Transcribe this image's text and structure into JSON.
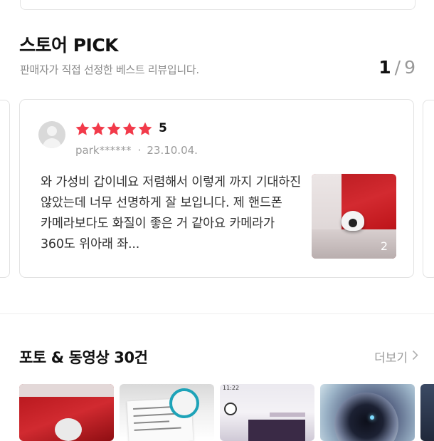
{
  "store_pick": {
    "title": "스토어 PICK",
    "subtitle": "판매자가 직접 선정한 베스트 리뷰입니다.",
    "pager": {
      "current": "1",
      "separator": "/",
      "total": "9"
    }
  },
  "review": {
    "rating": "5",
    "stars_filled": 5,
    "star_color": "#f23a4a",
    "author": "park******",
    "date": "23.10.04.",
    "text": "와 가성비 갑이네요 저렴해서 이렇게 까지 기대하진 않았는데 너무 선명하게 잘 보입니다. 제 핸드폰 카메라보다도 화질이 좋은 거 같아요 카메라가 360도 위아래 좌...",
    "photo_count": "2"
  },
  "photos": {
    "title": "포토 & 동영상 30건",
    "more_label": "더보기",
    "status_time": "11:22"
  },
  "icons": {
    "avatar": "default-user-avatar",
    "star": "star-icon",
    "chevron": "chevron-right-icon"
  }
}
